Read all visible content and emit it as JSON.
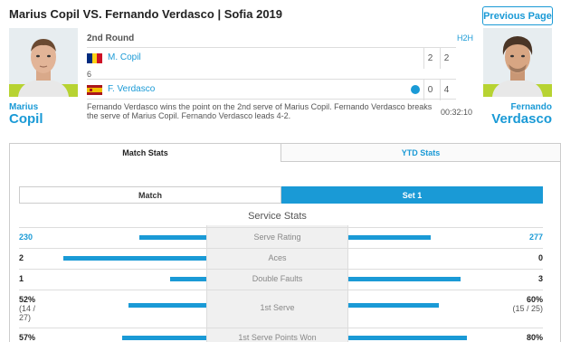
{
  "header": {
    "title": "Marius Copil VS. Fernando Verdasco | Sofia 2019",
    "prev_button": "Previous Page"
  },
  "match": {
    "round": "2nd Round",
    "h2h": "H2H",
    "elapsed": "00:32:10",
    "commentary": "Fernando Verdasco wins the point on the 2nd serve of Marius Copil.  Fernando Verdasco breaks the serve of Marius Copil. Fernando Verdasco leads 4-2."
  },
  "player1": {
    "first": "Marius",
    "last": "Copil",
    "short": "M. Copil",
    "flag": "romania-flag",
    "set1": "2",
    "set2": "2",
    "tiebreak": "6",
    "colors": {
      "flag": [
        "#002B7F",
        "#FCD116",
        "#CE1126"
      ]
    }
  },
  "player2": {
    "first": "Fernando",
    "last": "Verdasco",
    "short": "F. Verdasco",
    "flag": "spain-flag",
    "set1": "0",
    "set2": "4",
    "colors": {
      "flag": [
        "#AA151B",
        "#F1BF00",
        "#AA151B"
      ]
    }
  },
  "tabs": {
    "match_stats": "Match Stats",
    "ytd_stats": "YTD Stats"
  },
  "segments": {
    "match": "Match",
    "set1": "Set 1"
  },
  "section_title": "Service Stats",
  "stats": [
    {
      "label": "Serve Rating",
      "left": "230",
      "right": "277",
      "left_sub": "",
      "right_sub": "",
      "left_fill": 0.42,
      "right_fill": 0.52,
      "highlight": true
    },
    {
      "label": "Aces",
      "left": "2",
      "right": "0",
      "left_sub": "",
      "right_sub": "",
      "left_fill": 0.9,
      "right_fill": 0.0,
      "highlight": false
    },
    {
      "label": "Double Faults",
      "left": "1",
      "right": "3",
      "left_sub": "",
      "right_sub": "",
      "left_fill": 0.23,
      "right_fill": 0.71,
      "highlight": false
    },
    {
      "label": "1st Serve",
      "left": "52%",
      "right": "60%",
      "left_sub": "(14 / 27)",
      "right_sub": "(15 / 25)",
      "left_fill": 0.49,
      "right_fill": 0.57,
      "highlight": false
    },
    {
      "label": "1st Serve Points Won",
      "left": "57%",
      "right": "80%",
      "left_sub": "",
      "right_sub": "",
      "left_fill": 0.53,
      "right_fill": 0.75,
      "highlight": false
    }
  ],
  "accent_color": "#1a9ad6"
}
